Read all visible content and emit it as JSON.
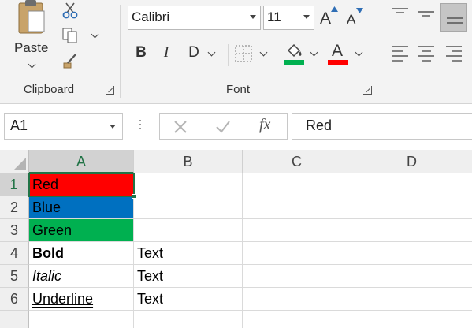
{
  "ribbon": {
    "clipboard": {
      "paste_label": "Paste",
      "group_label": "Clipboard"
    },
    "font": {
      "font_name": "Calibri",
      "font_size": "11",
      "bold_label": "B",
      "italic_label": "I",
      "underline_label": "D",
      "font_color_label": "A",
      "grow_label": "A",
      "shrink_label": "A",
      "fill_color": "#00b050",
      "font_color": "#ff0000",
      "group_label": "Font"
    }
  },
  "formula_bar": {
    "name_box": "A1",
    "fx_label": "fx",
    "value": "Red"
  },
  "sheet": {
    "columns": [
      "A",
      "B",
      "C",
      "D"
    ],
    "rows": [
      "1",
      "2",
      "3",
      "4",
      "5",
      "6",
      ""
    ],
    "cells": {
      "a1": "Red",
      "a2": "Blue",
      "a3": "Green",
      "a4": "Bold",
      "a5": "Italic",
      "a6": "Underline",
      "b4": "Text",
      "b5": "Text",
      "b6": "Text"
    },
    "fills": {
      "red": "#ff0000",
      "blue": "#0070c0",
      "green": "#00b050"
    }
  }
}
